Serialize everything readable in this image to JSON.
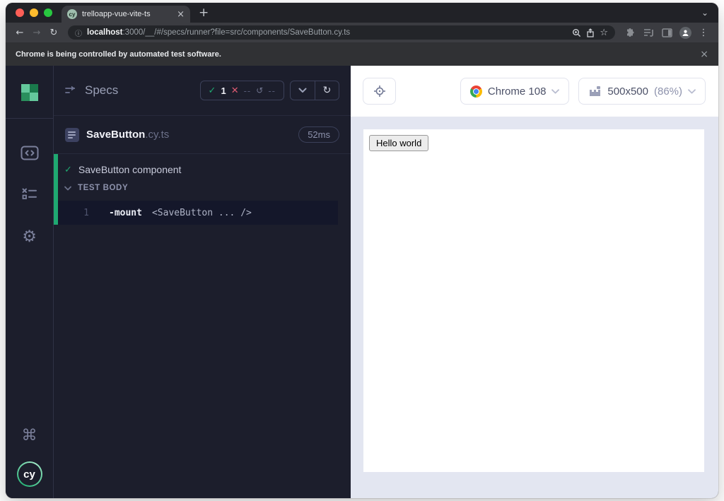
{
  "browser": {
    "tab_title": "trelloapp-vue-vite-ts",
    "tab_favicon_text": "cy",
    "tab_close_glyph": "×",
    "new_tab_glyph": "+",
    "tab_search_glyph": "⌄",
    "back_glyph": "←",
    "forward_glyph": "→",
    "reload_glyph": "↻",
    "info_glyph": "ⓘ",
    "url_host": "localhost",
    "url_rest": ":3000/__/#/specs/runner?file=src/components/SaveButton.cy.ts",
    "star_glyph": "☆",
    "menu_glyph": "⋮",
    "infobar_text": "Chrome is being controlled by automated test software.",
    "infobar_close_glyph": "×"
  },
  "sidebar": {
    "command_glyph": "⌘",
    "gear_glyph": "⚙",
    "cy_logo_text": "cy"
  },
  "specs": {
    "title": "Specs",
    "stats": {
      "pass_glyph": "✓",
      "passed": "1",
      "fail_glyph": "✕",
      "failed": "--",
      "pending_glyph": "↺",
      "pending": "--"
    },
    "reload_glyph": "↻",
    "file": {
      "name": "SaveButton",
      "ext": ".cy.ts",
      "duration": "52ms"
    },
    "test": {
      "pass_glyph": "✓",
      "title": "SaveButton component",
      "section": "TEST BODY",
      "command_line": "1",
      "command_name": "-mount",
      "command_args": "<SaveButton ... />"
    }
  },
  "preview": {
    "browser_label": "Chrome 108",
    "viewport_size": "500x500",
    "viewport_scale": "(86%)",
    "aut_button_label": "Hello world"
  },
  "colors": {
    "accent_green": "#1fa971",
    "fail_red": "#df5b72",
    "panel_bg": "#1c1e2c",
    "aut_bg": "#e3e6f1",
    "traffic_red": "#ff5f57",
    "traffic_yellow": "#febc2e",
    "traffic_green": "#28c840"
  }
}
